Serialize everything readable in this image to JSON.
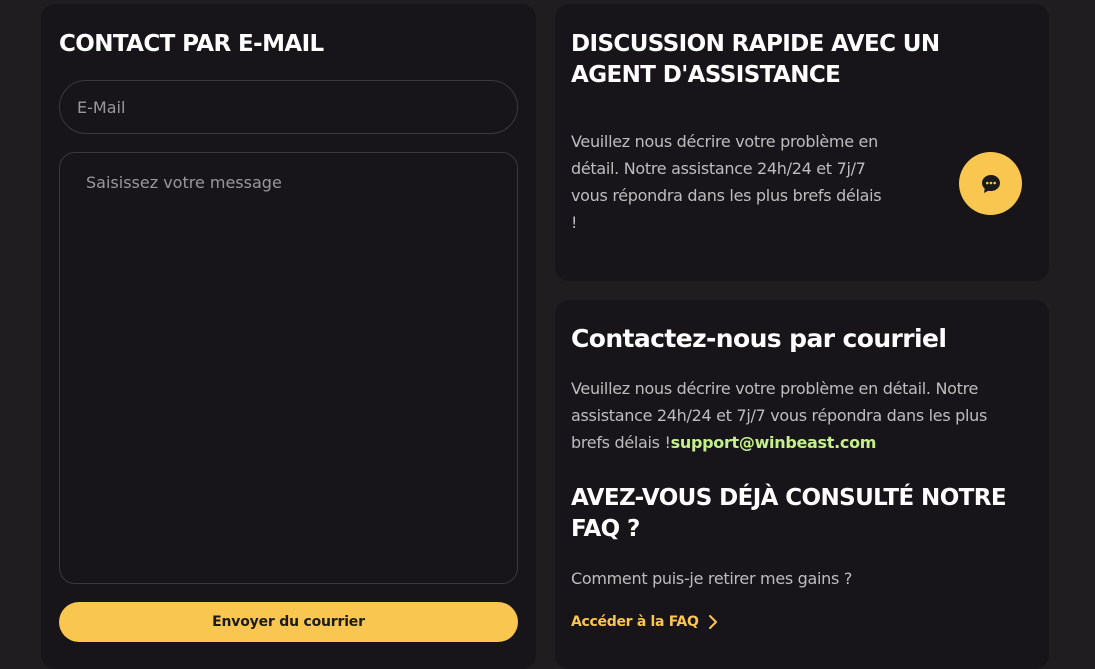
{
  "email_form": {
    "title": "CONTACT PAR E-MAIL",
    "email_placeholder": "E-Mail",
    "email_value": "",
    "message_placeholder": "Saisissez votre message",
    "message_value": "",
    "send_label": "Envoyer du courrier"
  },
  "chat": {
    "title": "DISCUSSION RAPIDE AVEC UN AGENT D'ASSISTANCE",
    "description": "Veuillez nous décrire votre problème en détail. Notre assistance 24h/24 et 7j/7 vous répondra dans les plus brefs délais !",
    "button_icon": "chat-bubble-icon"
  },
  "mail_contact": {
    "title": "Contactez-nous par courriel",
    "description": "Veuillez nous décrire votre problème en détail. Notre assistance 24h/24 et 7j/7 vous répondra dans les plus brefs délais !",
    "support_email": "support@winbeast.com"
  },
  "faq": {
    "title": "AVEZ-VOUS DÉJÀ CONSULTÉ NOTRE FAQ ?",
    "question": "Comment puis-je retirer mes gains ?",
    "link_label": "Accéder à la FAQ",
    "link_icon": "chevron-right-icon"
  },
  "colors": {
    "page_background": "#1f1d20",
    "card_background": "#18151a",
    "accent": "#f9c74f",
    "email_link": "#c4ef8a"
  }
}
